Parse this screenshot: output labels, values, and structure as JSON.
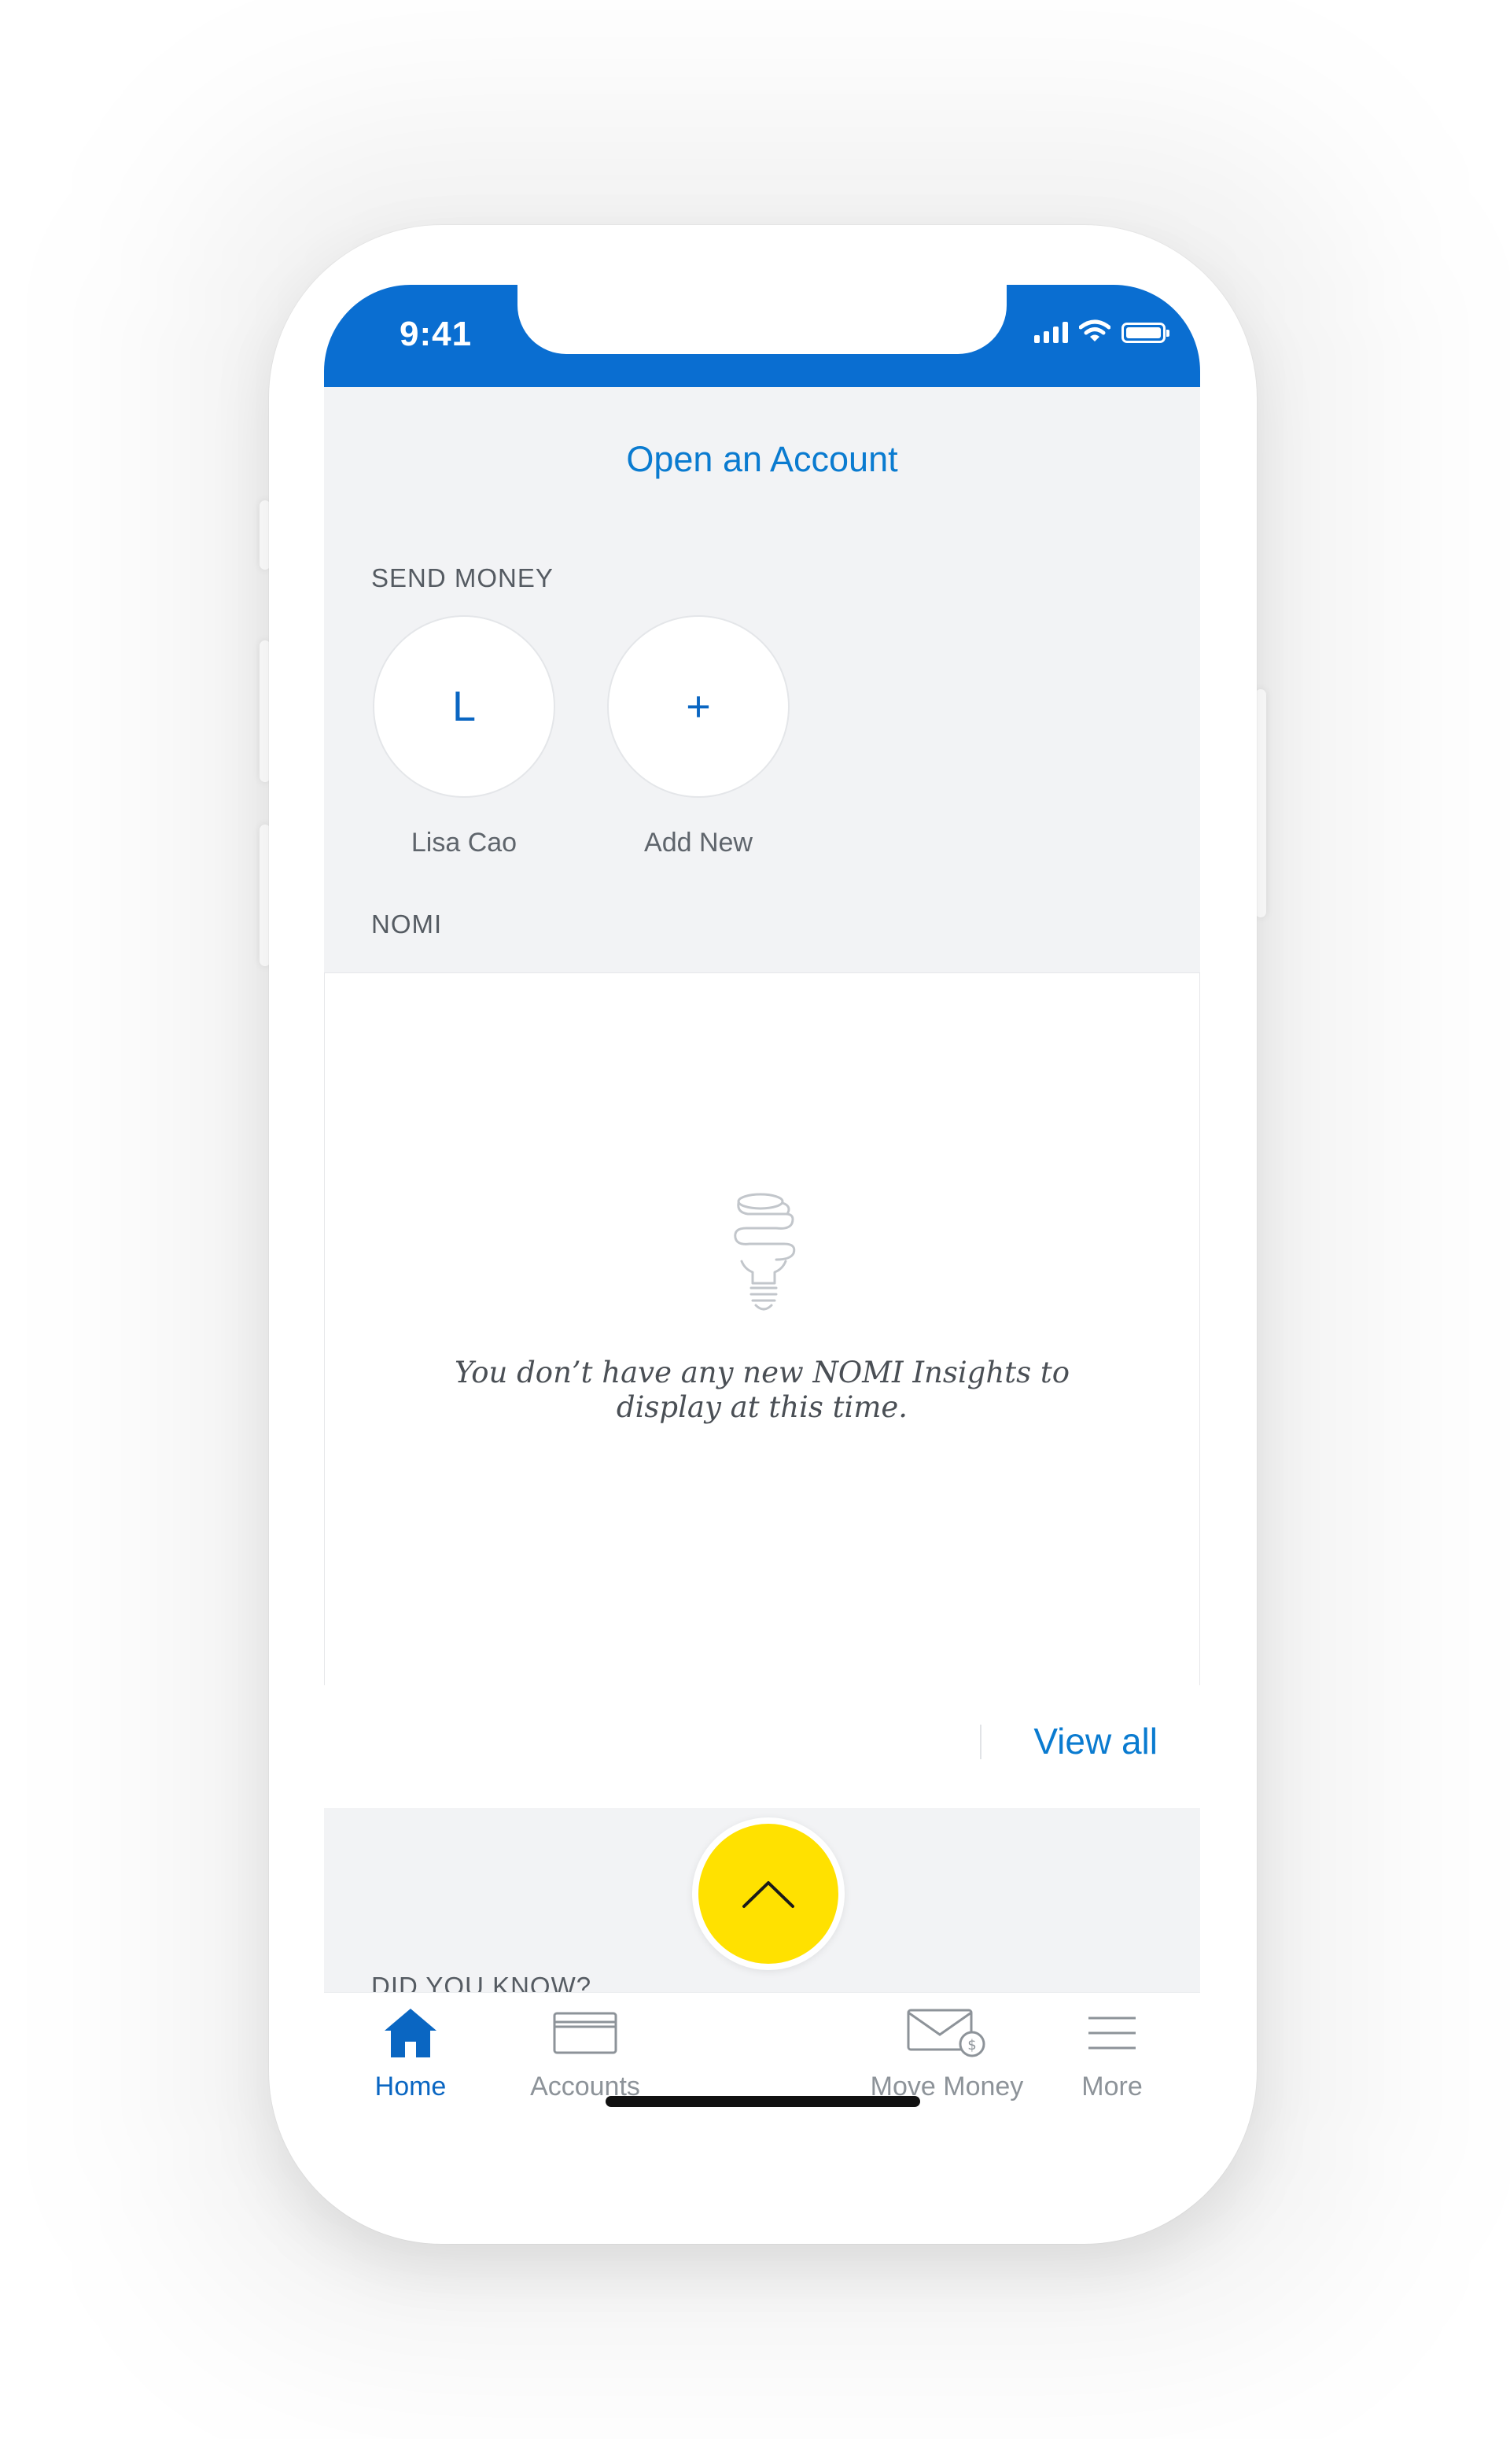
{
  "status_bar": {
    "time": "9:41",
    "bar_color": "#0a6ed1"
  },
  "header": {
    "open_account": "Open an Account"
  },
  "send_money": {
    "section_label": "SEND MONEY",
    "contacts": [
      {
        "initial": "L",
        "name": "Lisa Cao"
      },
      {
        "initial": "+",
        "name": "Add New"
      }
    ]
  },
  "nomi": {
    "section_label": "NOMI",
    "icon": "lightbulb-icon",
    "message": "You don’t have any new NOMI Insights to display at this time.",
    "view_all": "View all"
  },
  "did_you_know": {
    "section_label": "DID YOU KNOW?"
  },
  "tab_bar": {
    "tabs": [
      {
        "label": "Home",
        "icon": "home-icon",
        "active": true
      },
      {
        "label": "Accounts",
        "icon": "card-icon",
        "active": false
      },
      {
        "label": "Move Money",
        "icon": "envelope-dollar-icon",
        "active": false
      },
      {
        "label": "More",
        "icon": "hamburger-icon",
        "active": false
      }
    ],
    "fab_icon": "chevron-up-icon",
    "fab_color": "#ffe100",
    "accent_color": "#0a66c2"
  }
}
